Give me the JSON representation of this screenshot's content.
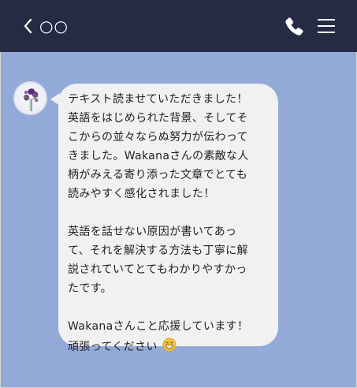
{
  "header": {
    "title": "○○"
  },
  "icons": {
    "back": "chevron-left-icon",
    "phone": "phone-icon",
    "menu": "menu-icon",
    "avatar": "avatar-flower-icon",
    "emoji": "grinning-face-icon"
  },
  "colors": {
    "header_bg": "#262b44",
    "chat_bg": "#93a9d7",
    "bubble_bg": "#f1f1f1",
    "text": "#222222"
  },
  "message": {
    "lines": [
      "テキスト読ませていただきました！",
      "英語をはじめられた背景、そしてそ",
      "こからの並々ならぬ努力が伝わって",
      "きました。Wakanaさんの素敵な人",
      "柄がみえる寄り添った文章でとても",
      "読みやすく感化されました！",
      "英語を話せない原因が書いてあっ",
      "て、それを解決する方法も丁寧に解",
      "説されていてとてもわかりやすかっ",
      "たです。",
      "Wakanaさんこと応援しています！",
      "頑張ってください"
    ]
  }
}
